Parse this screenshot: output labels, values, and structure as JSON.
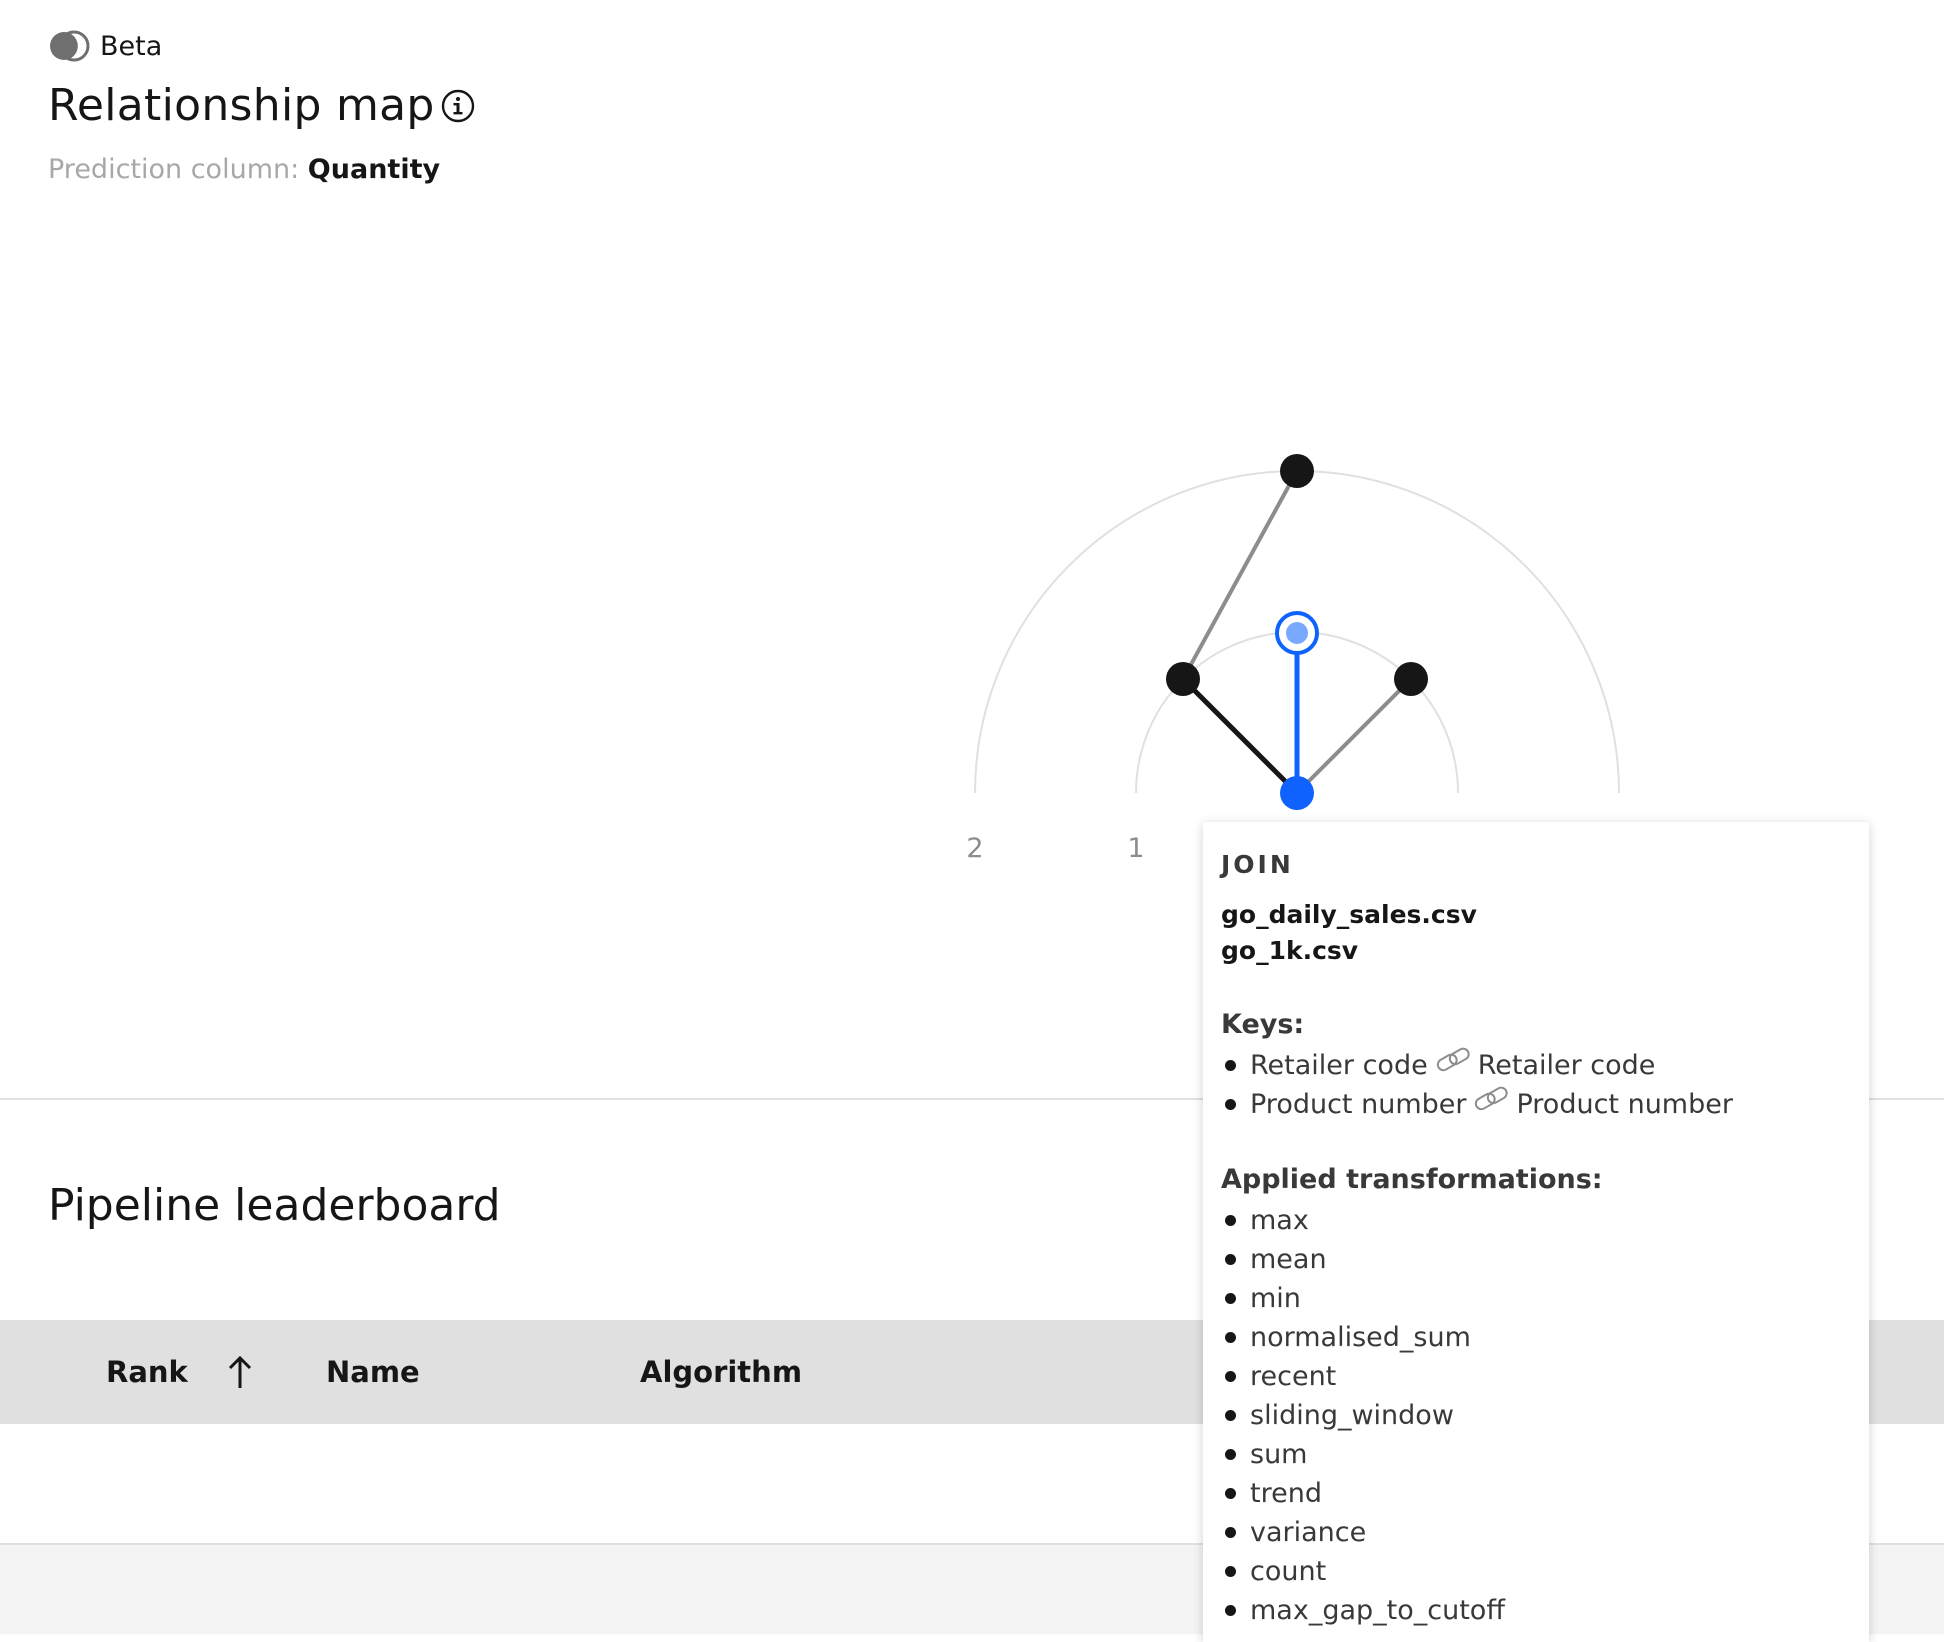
{
  "header": {
    "badge_label": "Beta",
    "title": "Relationship map",
    "prediction_label": "Prediction column:",
    "prediction_value": "Quantity"
  },
  "map": {
    "ring_labels": [
      "2",
      "1"
    ],
    "colors": {
      "selected": "#0f62fe",
      "selected_light": "#78a9ff",
      "node": "#161616",
      "edge": "#8d8d8d",
      "ring": "#e0e0e0"
    }
  },
  "tooltip": {
    "heading": "JOIN",
    "files": [
      "go_daily_sales.csv",
      "go_1k.csv"
    ],
    "keys_label": "Keys:",
    "keys": [
      {
        "left": "Retailer code",
        "right": "Retailer code"
      },
      {
        "left": "Product number",
        "right": "Product number"
      }
    ],
    "transformations_label": "Applied transformations:",
    "transformations": [
      "max",
      "mean",
      "min",
      "normalised_sum",
      "recent",
      "sliding_window",
      "sum",
      "trend",
      "variance",
      "count",
      "max_gap_to_cutoff"
    ]
  },
  "leaderboard": {
    "title": "Pipeline leaderboard",
    "columns": [
      "Rank",
      "Name",
      "Algorithm"
    ]
  }
}
